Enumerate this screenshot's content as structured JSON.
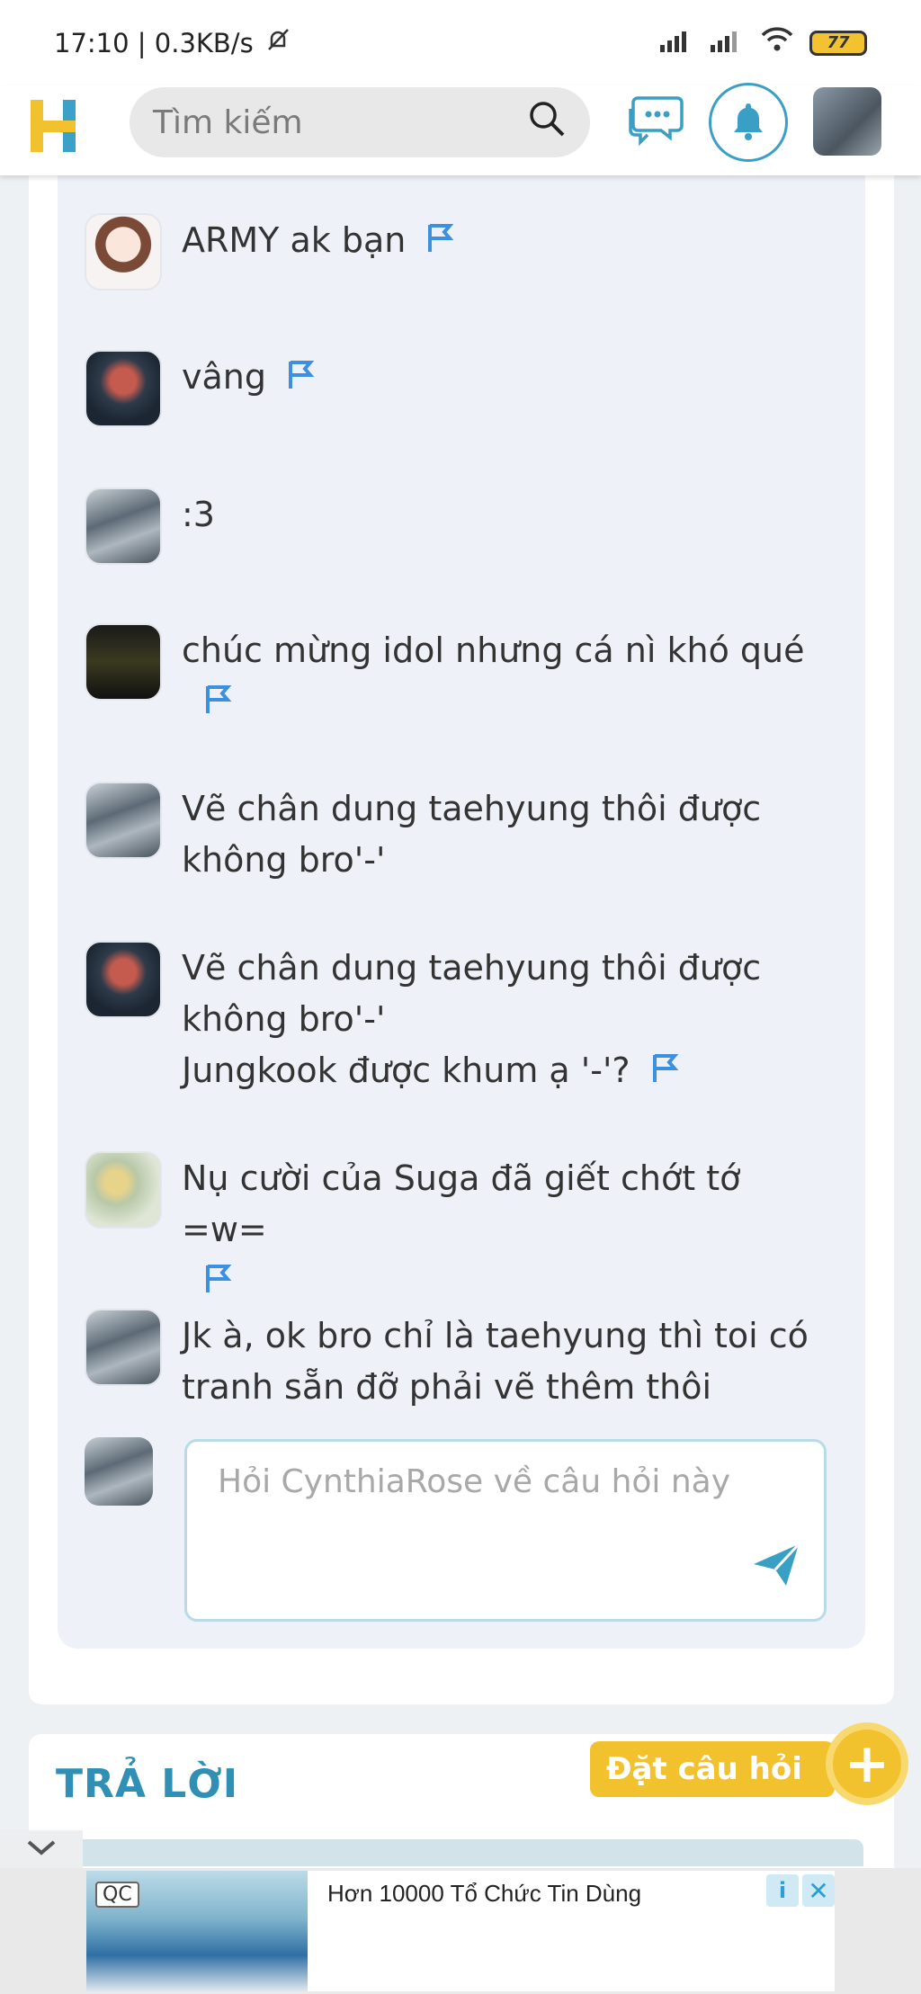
{
  "status_bar": {
    "time_speed": "17:10 | 0.3KB/s",
    "battery": "77"
  },
  "header": {
    "search_placeholder": "Tìm kiếm"
  },
  "comments": [
    {
      "text": "ARMY ak bạn",
      "avatar": "girl-drawing"
    },
    {
      "text": "vâng",
      "avatar": "dark-portrait"
    },
    {
      "text": ":3",
      "avatar": "city"
    },
    {
      "text": "chúc mừng idol nhưng cá nì khó qué",
      "avatar": "list-screenshot"
    },
    {
      "text_lines": [
        "Vẽ chân dung taehyung thôi được",
        "không bro'-'"
      ],
      "avatar": "city"
    },
    {
      "text_lines": [
        "Vẽ chân dung taehyung thôi được",
        "không bro'-'",
        "Jungkook được khum ạ '-'?"
      ],
      "avatar": "dark-portrait"
    },
    {
      "text": "Nụ cười của Suga đã giết chớt tớ =w=",
      "avatar": "flower"
    },
    {
      "text_lines": [
        "Jk à, ok bro chỉ là taehyung thì toi có",
        "tranh sẵn đỡ phải vẽ thêm thôi"
      ],
      "avatar": "city"
    }
  ],
  "ask": {
    "placeholder": "Hỏi CynthiaRose về câu hỏi này"
  },
  "answers": {
    "title": "TRẢ LỜI",
    "ask_question_label": "Đặt câu hỏi",
    "plus": "+"
  },
  "ad": {
    "tag": "QC",
    "text": "Hơn 10000 Tổ Chức Tin Dùng",
    "info": "i",
    "close": "✕"
  },
  "colors": {
    "accent": "#3a9fc4",
    "flag": "#3d8fe0",
    "fab": "#f2c12e"
  }
}
